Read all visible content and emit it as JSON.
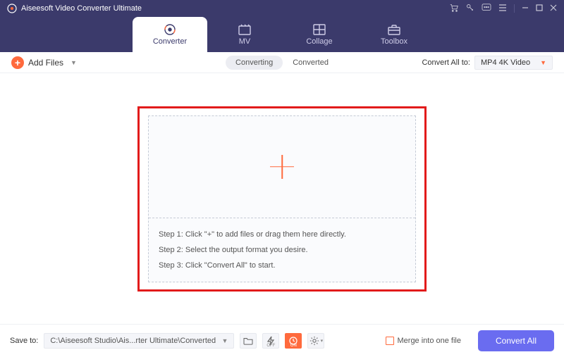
{
  "titlebar": {
    "app": "Aiseesoft Video Converter Ultimate"
  },
  "nav": {
    "tabs": [
      {
        "label": "Converter"
      },
      {
        "label": "MV"
      },
      {
        "label": "Collage"
      },
      {
        "label": "Toolbox"
      }
    ]
  },
  "topstrip": {
    "addFiles": "Add Files",
    "sub": [
      {
        "label": "Converting"
      },
      {
        "label": "Converted"
      }
    ],
    "convertToLabel": "Convert All to:",
    "format": "MP4 4K Video"
  },
  "dropzone": {
    "steps": [
      "Step 1: Click \"+\" to add files or drag them here directly.",
      "Step 2: Select the output format you desire.",
      "Step 3: Click \"Convert All\" to start."
    ]
  },
  "bottom": {
    "saveToLabel": "Save to:",
    "path": "C:\\Aiseesoft Studio\\Ais...rter Ultimate\\Converted",
    "merge": "Merge into one file",
    "convertAll": "Convert All"
  }
}
